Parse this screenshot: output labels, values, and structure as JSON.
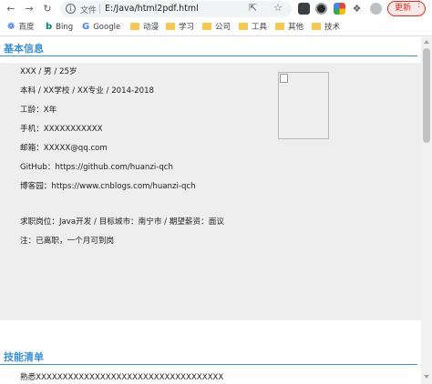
{
  "browser": {
    "back_icon": "arrow-left",
    "forward_icon": "arrow-right",
    "reload_icon": "reload",
    "info_icon": "info",
    "scheme_label": "文件",
    "url": "E:/Java/html2pdf.html",
    "update_label": "更新",
    "accent_color": "#d93025"
  },
  "bookmarks": [
    {
      "label": "百度",
      "icon": "paw-icon"
    },
    {
      "label": "Bing",
      "icon": "bing-icon"
    },
    {
      "label": "Google",
      "icon": "google-icon"
    },
    {
      "label": "动漫",
      "icon": "folder-icon"
    },
    {
      "label": "学习",
      "icon": "folder-icon"
    },
    {
      "label": "公司",
      "icon": "folder-icon"
    },
    {
      "label": "工具",
      "icon": "folder-icon"
    },
    {
      "label": "其他",
      "icon": "folder-icon"
    },
    {
      "label": "技术",
      "icon": "folder-icon"
    }
  ],
  "page": {
    "basic_info": {
      "title": "基本信息",
      "title_color": "#3d8fd6",
      "lines": [
        "XXX  /  男  /  25岁",
        "本科  /  XX学校  /  XX专业  /  2014-2018",
        "工龄：X年",
        "手机：XXXXXXXXXXX",
        "邮箱：XXXXX@qq.com",
        "GitHub：https://github.com/huanzi-qch",
        "博客园：https://www.cnblogs.com/huanzi-qch",
        "求职岗位：Java开发  /  目标城市：南宁市  /  期望薪资：面议",
        "注：已离职，一个月可到岗"
      ]
    },
    "skills": {
      "title": "技能清单",
      "first_line": "熟悉XXXXXXXXXXXXXXXXXXXXXXXXXXXXXXXXXXX"
    }
  }
}
